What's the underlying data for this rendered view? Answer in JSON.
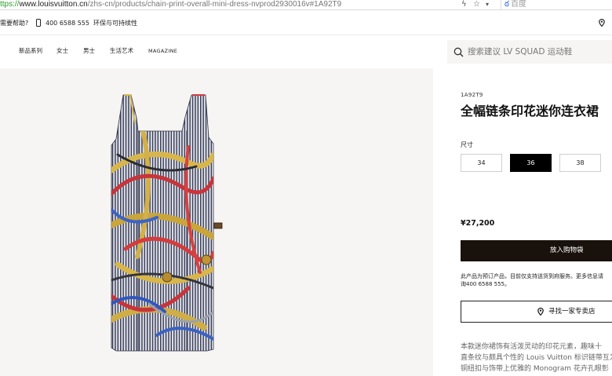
{
  "browser": {
    "url_protocol": "ttps://",
    "url_host": "www.louisvuitton.cn",
    "url_path": "/zhs-cn/products/chain-print-overall-mini-dress-nvprod2930016v#1A92T9",
    "search_engine": "百度"
  },
  "utility": {
    "help": "需要帮助?",
    "phone": "400 6588 555",
    "sustainability": "环保与可持续性"
  },
  "nav": {
    "items": [
      "新品系列",
      "女士",
      "男士",
      "生活艺术",
      "MAGAZINE"
    ],
    "search_placeholder": "搜索建议 LV SQUAD 运动鞋"
  },
  "product": {
    "sku": "1A92T9",
    "title": "全幅链条印花迷你连衣裙",
    "size_label": "尺寸",
    "sizes": [
      "34",
      "36",
      "38"
    ],
    "selected_size": "36",
    "price": "¥27,200",
    "add_to_cart": "放入购物袋",
    "notice_lines": [
      "此产品为预订产品，目前仅支持送货到府服务。更多信息请",
      "询400 6588 555。"
    ],
    "find_store": "寻找一家专卖店",
    "description_lines": [
      "本款迷你裙饰有活泼灵动的印花元素，趣味十",
      "直条纹与颇具个性的 Louis Vuitton 标识链带互为",
      "铜纽扣与饰带上优雅的 Monogram 花卉孔眼彰"
    ]
  },
  "colors": {
    "accent_dark": "#19110b",
    "image_background": "#f6f5f3"
  }
}
